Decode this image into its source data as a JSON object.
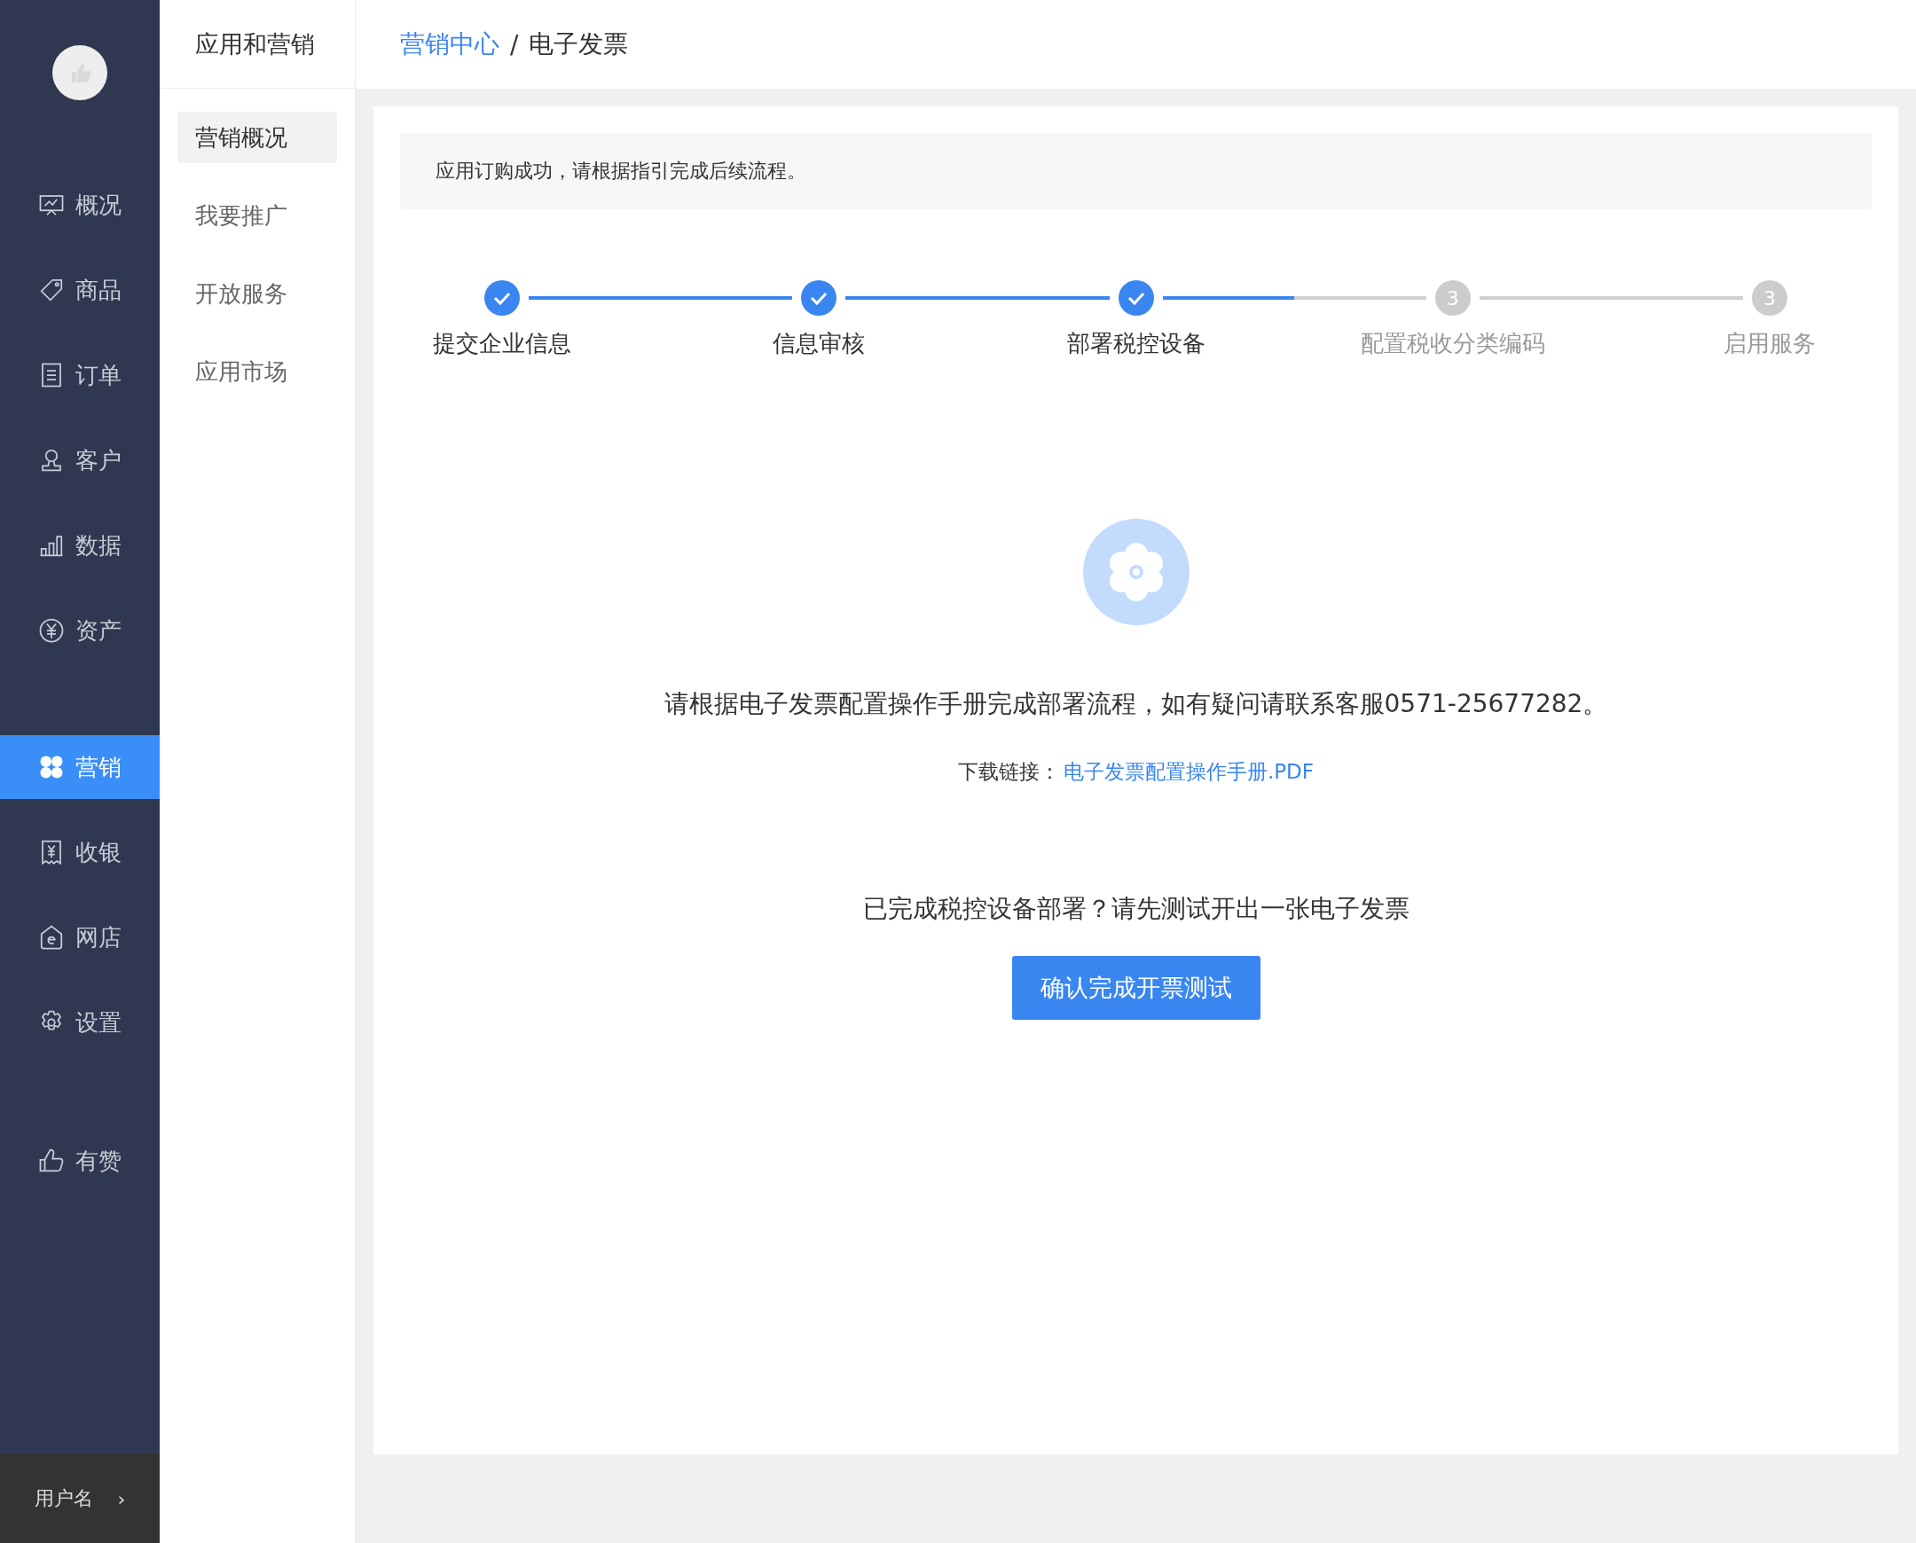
{
  "sidebar": {
    "groups": [
      [
        {
          "label": "概况",
          "selected": false
        },
        {
          "label": "商品",
          "selected": false
        },
        {
          "label": "订单",
          "selected": false
        },
        {
          "label": "客户",
          "selected": false
        },
        {
          "label": "数据",
          "selected": false
        },
        {
          "label": "资产",
          "selected": false
        }
      ],
      [
        {
          "label": "营销",
          "selected": true
        },
        {
          "label": "收银",
          "selected": false
        },
        {
          "label": "网店",
          "selected": false
        },
        {
          "label": "设置",
          "selected": false
        }
      ],
      [
        {
          "label": "有赞",
          "selected": false
        }
      ]
    ],
    "user": {
      "name": "用户名",
      "chevron": "›"
    }
  },
  "subnav": {
    "title": "应用和营销",
    "items": [
      {
        "label": "营销概况",
        "selected": true
      },
      {
        "label": "我要推广",
        "selected": false
      },
      {
        "label": "开放服务",
        "selected": false
      },
      {
        "label": "应用市场",
        "selected": false
      }
    ]
  },
  "breadcrumb": {
    "separator": "/",
    "items": [
      {
        "label": "营销中心",
        "kind": "link"
      },
      {
        "label": "电子发票",
        "kind": "current"
      }
    ]
  },
  "notice": "应用订购成功，请根据指引完成后续流程。",
  "steps": [
    {
      "label": "提交企业信息",
      "done": true,
      "level": 1
    },
    {
      "label": "信息审核",
      "done": true,
      "level": 1
    },
    {
      "label": "部署税控设备",
      "done": true,
      "level": 0.5
    },
    {
      "label": "配置税收分类编码",
      "done": false,
      "number": "3"
    },
    {
      "label": "启用服务",
      "done": false,
      "number": "3"
    }
  ],
  "message": "请根据电子发票配置操作手册完成部署流程，如有疑问请联系客服0571-25677282。",
  "download": {
    "label": "下载链接：",
    "link": "电子发票配置操作手册.PDF"
  },
  "question": "已完成税控设备部署？请先测试开出一张电子发票",
  "button": "确认完成开票测试"
}
